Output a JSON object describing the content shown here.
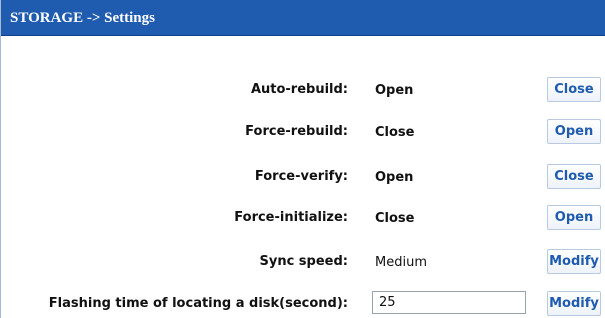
{
  "header": {
    "title": "STORAGE -> Settings"
  },
  "settings": [
    {
      "label": "Auto-rebuild:",
      "value": "Open",
      "button": "Close"
    },
    {
      "label": "Force-rebuild:",
      "value": "Close",
      "button": "Open"
    },
    {
      "label": "Force-verify:",
      "value": "Open",
      "button": "Close"
    },
    {
      "label": "Force-initialize:",
      "value": "Close",
      "button": "Open"
    },
    {
      "label": "Sync speed:",
      "value": "Medium",
      "button": "Modify"
    },
    {
      "label": "Flashing time of locating a disk(second):",
      "value": "25",
      "button": "Modify"
    }
  ],
  "colors": {
    "header_bg": "#1f5bae",
    "button_text": "#1f5bae"
  }
}
